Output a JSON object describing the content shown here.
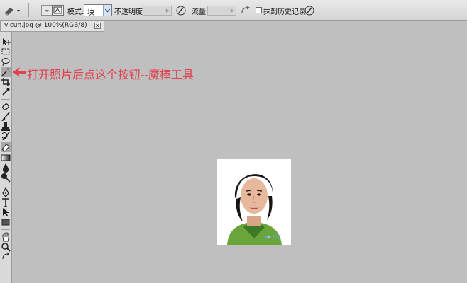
{
  "options_bar": {
    "mode_label": "模式:",
    "mode_value": "块",
    "opacity_label": "不透明度:",
    "flow_label": "流量:",
    "erase_history_label": "抹到历史记录"
  },
  "document": {
    "tab_title": "yicun.jpg @ 100%(RGB/8)",
    "close_glyph": "✕"
  },
  "annotation": {
    "text": "打开照片后点这个按钮--魔棒工具",
    "color": "#e0414f"
  },
  "photo": {
    "watermark_text": "百度"
  },
  "tools": [
    "move-tool",
    "marquee-tool",
    "lasso-tool",
    "magic-wand-tool",
    "crop-tool",
    "eyedropper-tool",
    "healing-brush-tool",
    "brush-tool",
    "clone-stamp-tool",
    "history-brush-tool",
    "eraser-tool",
    "gradient-tool",
    "blur-tool",
    "dodge-tool",
    "pen-tool",
    "type-tool",
    "path-selection-tool",
    "shape-tool",
    "hand-tool",
    "zoom-tool"
  ]
}
